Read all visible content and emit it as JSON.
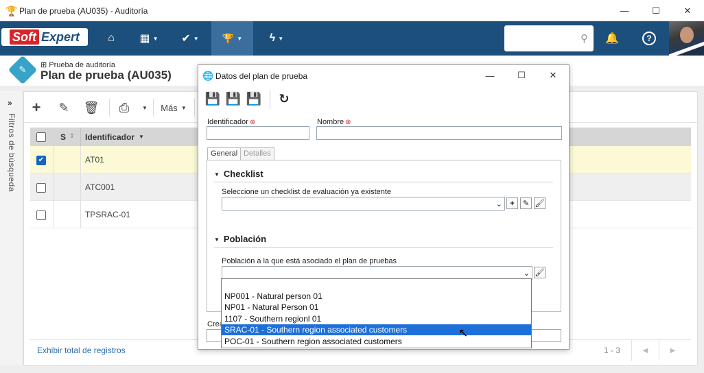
{
  "window": {
    "title": "Plan de prueba (AU035) - Auditoría",
    "app_icon": "trophy-icon",
    "minimize": "—",
    "maximize": "☐",
    "close": "✕"
  },
  "topnav": {
    "logo_soft": "Soft",
    "logo_expert": "Expert",
    "search_placeholder": "",
    "items": [
      {
        "icon": "home-icon",
        "glyph": "⌂"
      },
      {
        "icon": "dashboard-icon",
        "glyph": "▦"
      },
      {
        "icon": "check-icon",
        "glyph": "✔"
      },
      {
        "icon": "trophy-icon",
        "glyph": "🏆"
      },
      {
        "icon": "lightning-icon",
        "glyph": "ϟ"
      }
    ],
    "bell": "🔔",
    "help": "?"
  },
  "header": {
    "breadcrumb_prefix": "⊞",
    "breadcrumb": "Prueba de auditoría",
    "title": "Plan de prueba (AU035)"
  },
  "filter_panel": {
    "label": "Filtros de búsqueda"
  },
  "toolbar": {
    "more_label": "Más"
  },
  "grid": {
    "columns": [
      "S",
      "Identificador"
    ],
    "rows": [
      {
        "id": "AT01",
        "checked": true
      },
      {
        "id": "ATC001",
        "checked": false
      },
      {
        "id": "TPSRAC-01",
        "checked": false
      }
    ],
    "footer_link": "Exhibir total de registros",
    "pagination": "1 - 3"
  },
  "dialog": {
    "title": "Datos del plan de prueba",
    "identificador_label": "Identificador",
    "identificador_value": "",
    "nombre_label": "Nombre",
    "nombre_value": "",
    "tabs": [
      "General",
      "Detalles"
    ],
    "checklist": {
      "heading": "Checklist",
      "field_label": "Seleccione un checklist de evaluación ya existente",
      "value": ""
    },
    "poblacion": {
      "heading": "Población",
      "field_label": "Población a la que está asociado el plan de pruebas",
      "value": "",
      "options": [
        "",
        "NP001 - Natural person 01",
        "NP01 - Natural Person 01",
        "1107 - Southern regionl 01",
        "SRAC-01 - Southern region associated customers",
        "POC-01 - Southern region associated customers"
      ],
      "highlighted_index": 4
    },
    "partial_label": "Crea"
  },
  "colors": {
    "nav_bg": "#1d4f7c",
    "nav_active": "#3b6e9d",
    "selected_row": "#fbf9d6",
    "highlight": "#1e6fd9",
    "required": "#d9252a"
  }
}
